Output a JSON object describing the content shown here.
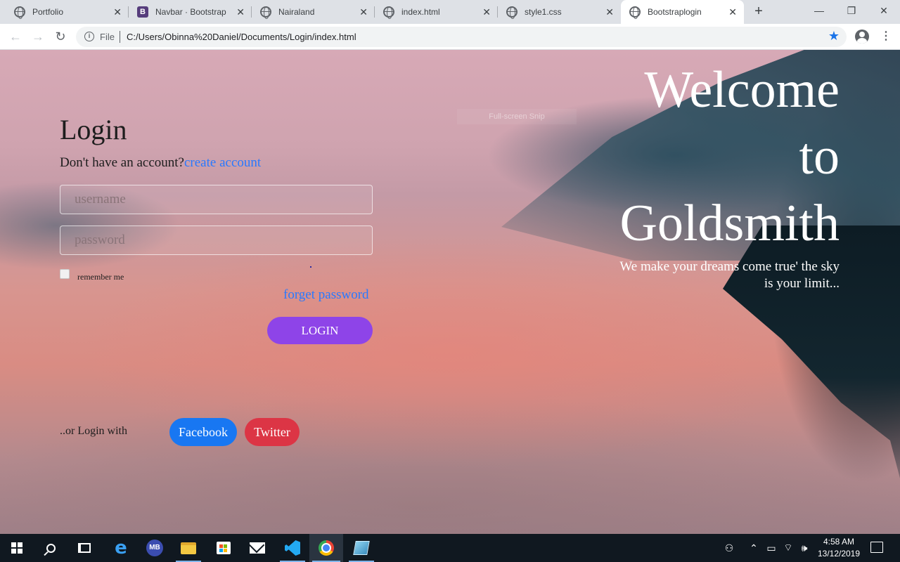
{
  "browser": {
    "tabs": [
      {
        "title": "Portfolio",
        "icon": "globe-icon",
        "active": false
      },
      {
        "title": "Navbar · Bootstrap",
        "icon": "bootstrap-icon",
        "active": false
      },
      {
        "title": "Nairaland",
        "icon": "globe-icon",
        "active": false
      },
      {
        "title": "index.html",
        "icon": "globe-icon",
        "active": false
      },
      {
        "title": "style1.css",
        "icon": "globe-icon",
        "active": false
      },
      {
        "title": "Bootstraplogin",
        "icon": "globe-icon",
        "active": true
      }
    ],
    "bootstrap_letter": "B",
    "close_glyph": "✕",
    "new_tab_glyph": "+",
    "window_controls": {
      "minimize": "—",
      "restore": "❐",
      "close": "✕"
    },
    "nav": {
      "back": "←",
      "forward": "→",
      "reload": "↻"
    },
    "address": {
      "info_glyph": "i",
      "scheme_label": "File",
      "url": "C:/Users/Obinna%20Daniel/Documents/Login/index.html",
      "bookmark_glyph": "★"
    },
    "menu_glyph": "⋮"
  },
  "page": {
    "overlay_hint": "Full-screen Snip",
    "login": {
      "title": "Login",
      "account_prompt": "Don't have an account?",
      "create_account": "create account",
      "username_placeholder": "username",
      "password_placeholder": "password",
      "remember_label": "remember me",
      "forget_password": "forget password",
      "login_button": "LOGIN",
      "or_login_with": "..or Login with",
      "facebook_button": "Facebook",
      "twitter_button": "Twitter"
    },
    "hero": {
      "line1": "Welcome",
      "line2": "to",
      "line3": "Goldsmith",
      "tagline": "We make your dreams come true' the sky is your limit..."
    }
  },
  "taskbar": {
    "mb_label": "MB",
    "edge_glyph": "e",
    "tray": {
      "people": "⚇",
      "chevron": "⌃",
      "battery": "▭",
      "wifi": "⌔",
      "volume": "🕪"
    },
    "time": "4:58 AM",
    "date": "13/12/2019"
  },
  "colors": {
    "accent_link": "#2979ff",
    "login_button": "#8e44e8",
    "facebook": "#1877f2",
    "twitter": "#dc3545"
  }
}
